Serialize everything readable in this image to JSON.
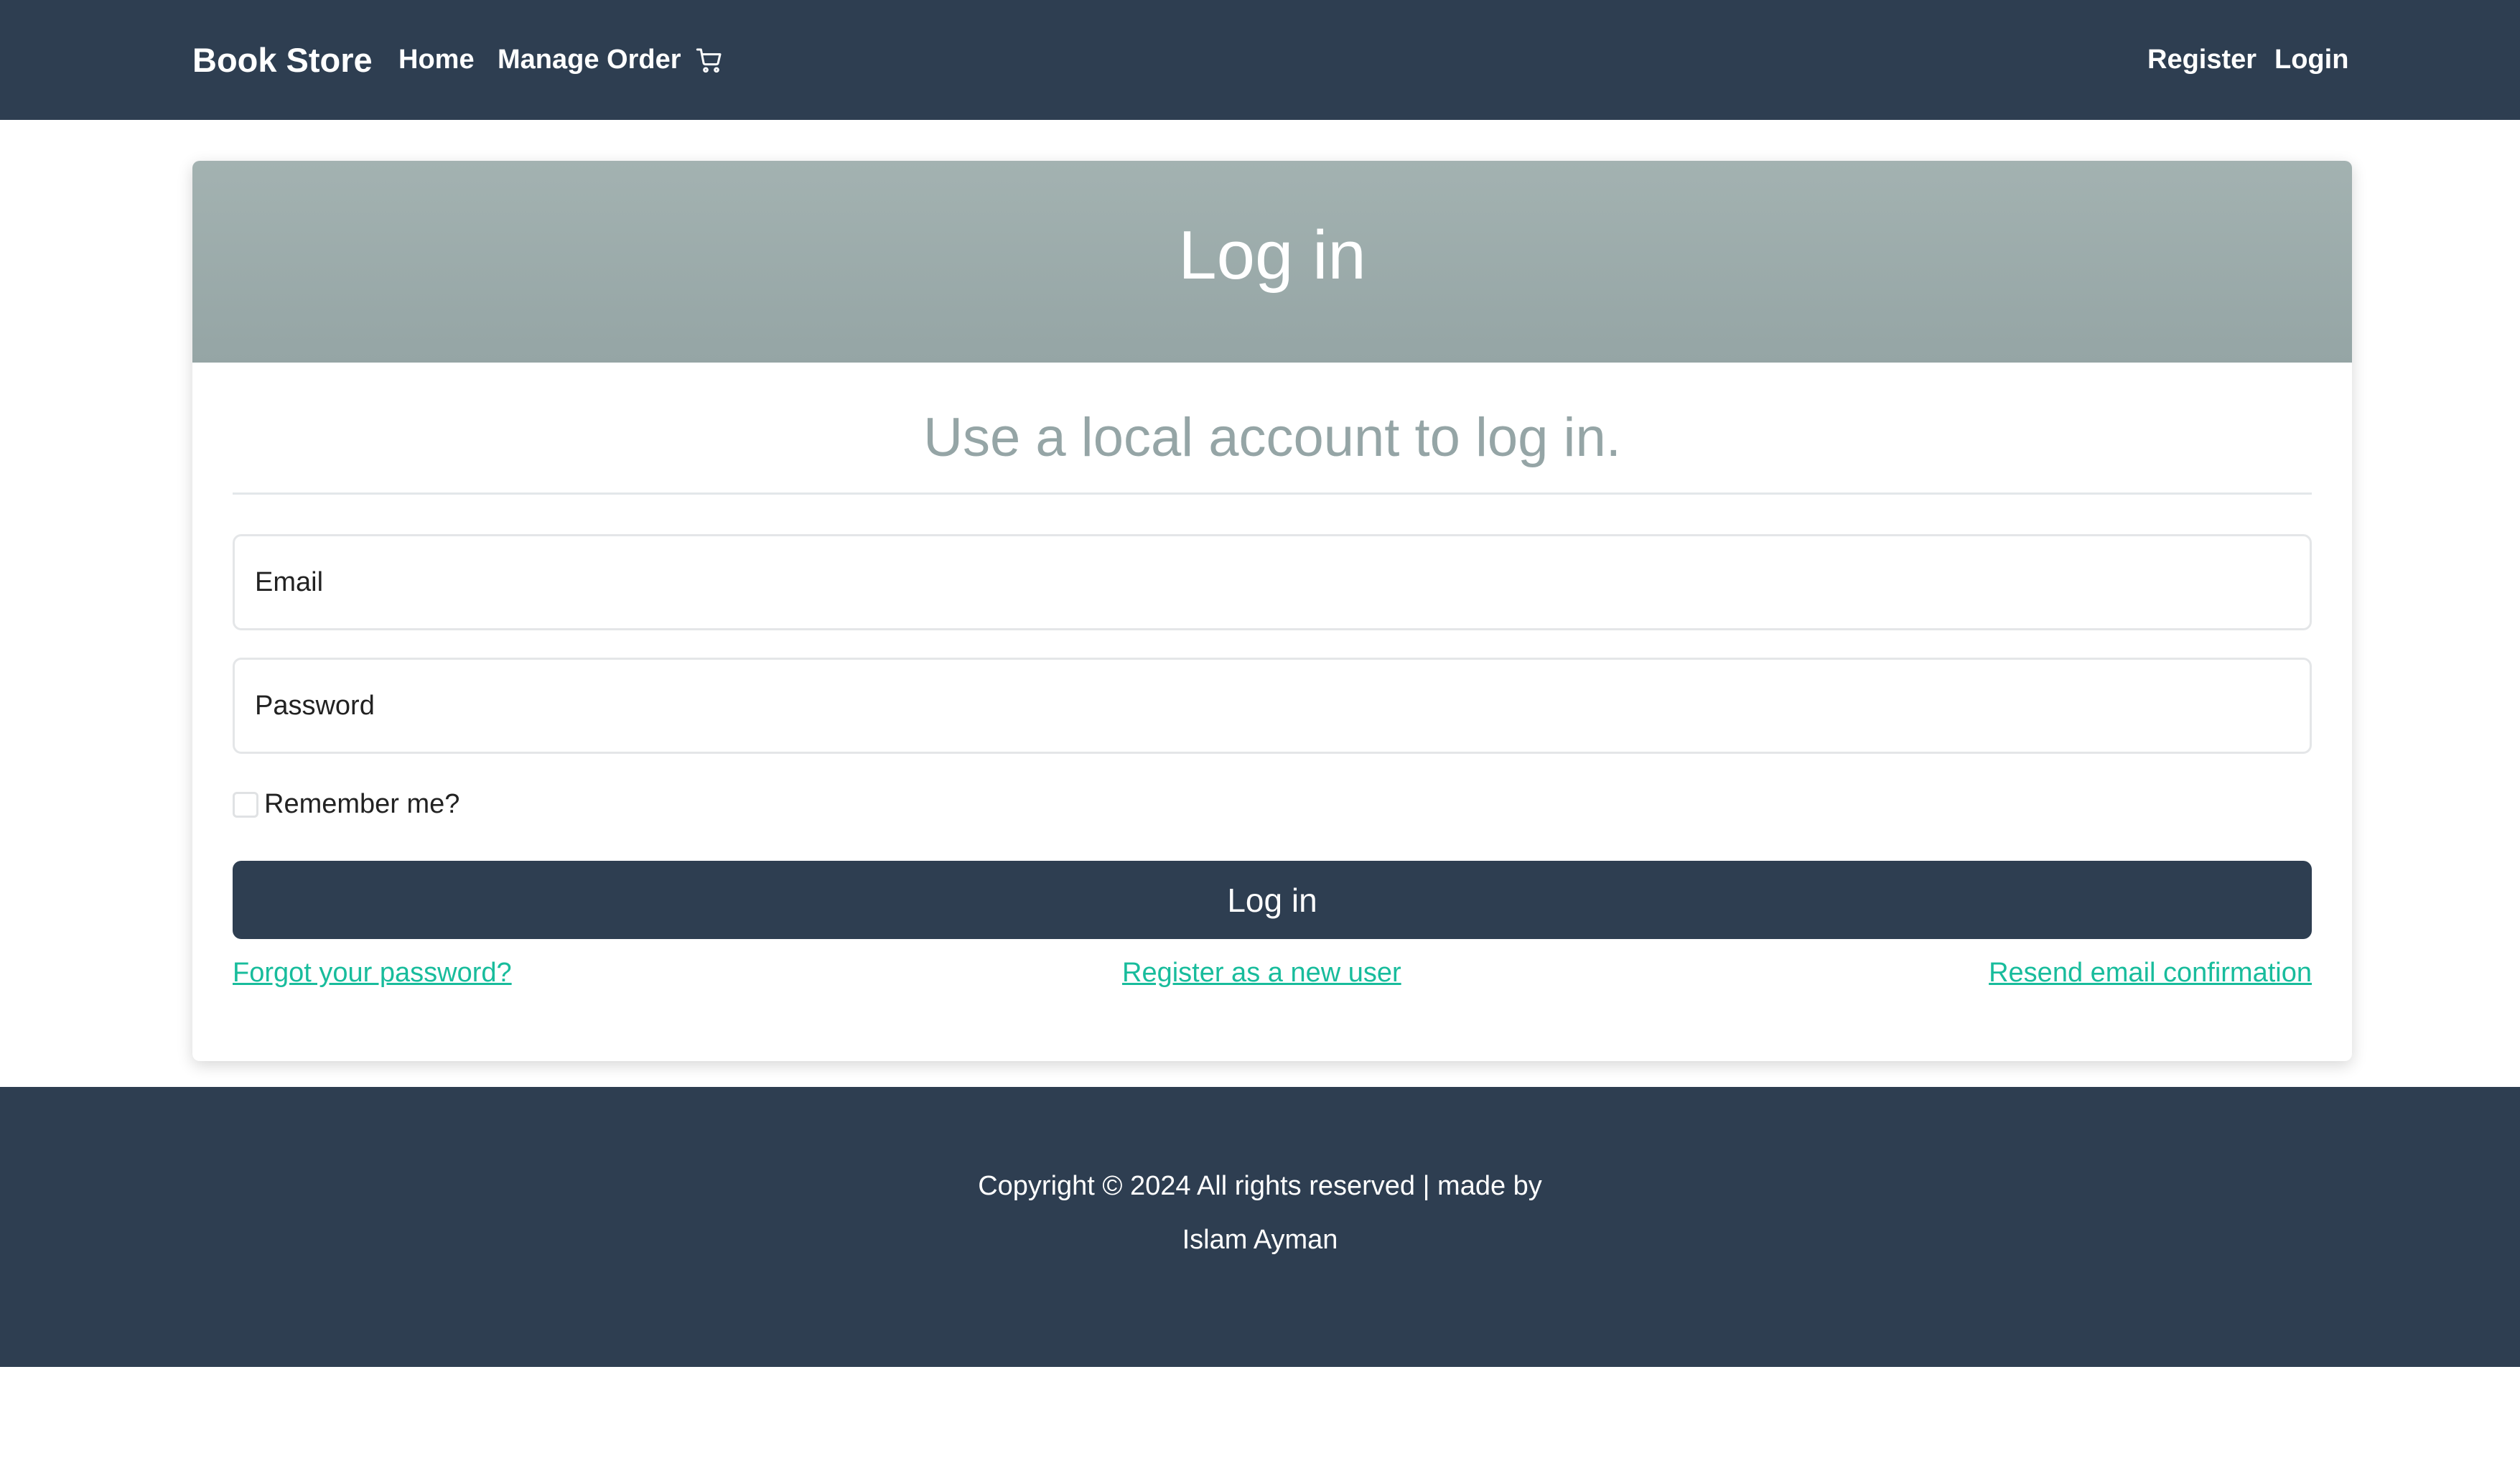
{
  "navbar": {
    "brand": "Book Store",
    "links": [
      {
        "label": "Home"
      },
      {
        "label": "Manage Order"
      }
    ],
    "cart_icon": "cart-icon",
    "right_links": [
      {
        "label": "Register"
      },
      {
        "label": "Login"
      }
    ]
  },
  "login_card": {
    "title": "Log in",
    "subtitle": "Use a local account to log in.",
    "email_label": "Email",
    "password_label": "Password",
    "remember_label": "Remember me?",
    "remember_checked": false,
    "submit_label": "Log in",
    "links": {
      "forgot": "Forgot your password?",
      "register": "Register as a new user",
      "resend": "Resend email confirmation"
    }
  },
  "footer": {
    "line1": "Copyright © 2024 All rights reserved | made by",
    "line2": "Islam Ayman"
  },
  "colors": {
    "navbar_bg": "#2e3e51",
    "header_bg": "#9aabab",
    "subtitle": "#95a5a6",
    "link": "#18bc9c",
    "button_bg": "#2e3e51"
  }
}
